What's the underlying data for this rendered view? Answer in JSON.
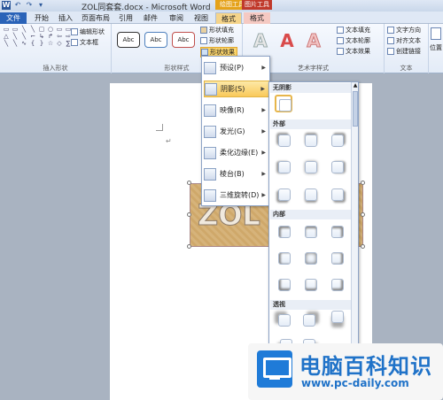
{
  "titlebar": {
    "title": "ZOL同套套.docx - Microsoft Word",
    "context_picture_tools": "绘图工具",
    "context_drawing_tools": "图片工具",
    "qat": [
      "W",
      "↶",
      "↷",
      "▾"
    ]
  },
  "tabs": [
    "文件",
    "开始",
    "插入",
    "页面布局",
    "引用",
    "邮件",
    "审阅",
    "视图",
    "格式",
    "格式"
  ],
  "ribbon": {
    "insert_shapes": {
      "label": "插入形状",
      "edit_shape": "编辑形状",
      "text_box": "文本框",
      "shape_glyphs": [
        "▭",
        "▭",
        "╲",
        "╲",
        "▢",
        "○",
        "▭",
        "▭",
        "△",
        "╲",
        "╲",
        "⌐",
        "↳",
        "↱",
        "⇦",
        "⇨",
        "╲",
        "╲",
        "∿",
        "{",
        "}",
        "☆",
        "◇",
        "∑"
      ]
    },
    "shape_styles": {
      "label": "形状样式",
      "samples": [
        "Abc",
        "Abc",
        "Abc"
      ],
      "shape_fill": "形状填充",
      "shape_outline": "形状轮廓",
      "shape_effects": "形状效果"
    },
    "wordart_styles": {
      "label": "艺术字样式",
      "samples": [
        "A",
        "A",
        "A"
      ],
      "text_fill": "文本填充",
      "text_outline": "文本轮廓",
      "text_effects": "文本效果"
    },
    "text": {
      "label": "文本",
      "text_direction": "文字方向",
      "align_text": "对齐文本",
      "create_link": "创建链接"
    },
    "arrange": {
      "position": "位置"
    }
  },
  "effects_menu": {
    "items": [
      {
        "label": "预设(P)",
        "selected": false
      },
      {
        "label": "阴影(S)",
        "selected": true
      },
      {
        "label": "映像(R)",
        "selected": false
      },
      {
        "label": "发光(G)",
        "selected": false
      },
      {
        "label": "柔化边缘(E)",
        "selected": false
      },
      {
        "label": "棱台(B)",
        "selected": false
      },
      {
        "label": "三维旋转(D)",
        "selected": false
      }
    ]
  },
  "shadow_gallery": {
    "sections": [
      "无阴影",
      "外部",
      "内部",
      "透视"
    ]
  },
  "document": {
    "image_text": "ZOL"
  },
  "watermark": {
    "title": "电脑百科知识",
    "url": "www.pc-daily.com"
  },
  "colors": {
    "file_tab": "#2a63b8",
    "selected_item": "#f9c95a",
    "watermark_blue": "#1f72c8"
  }
}
